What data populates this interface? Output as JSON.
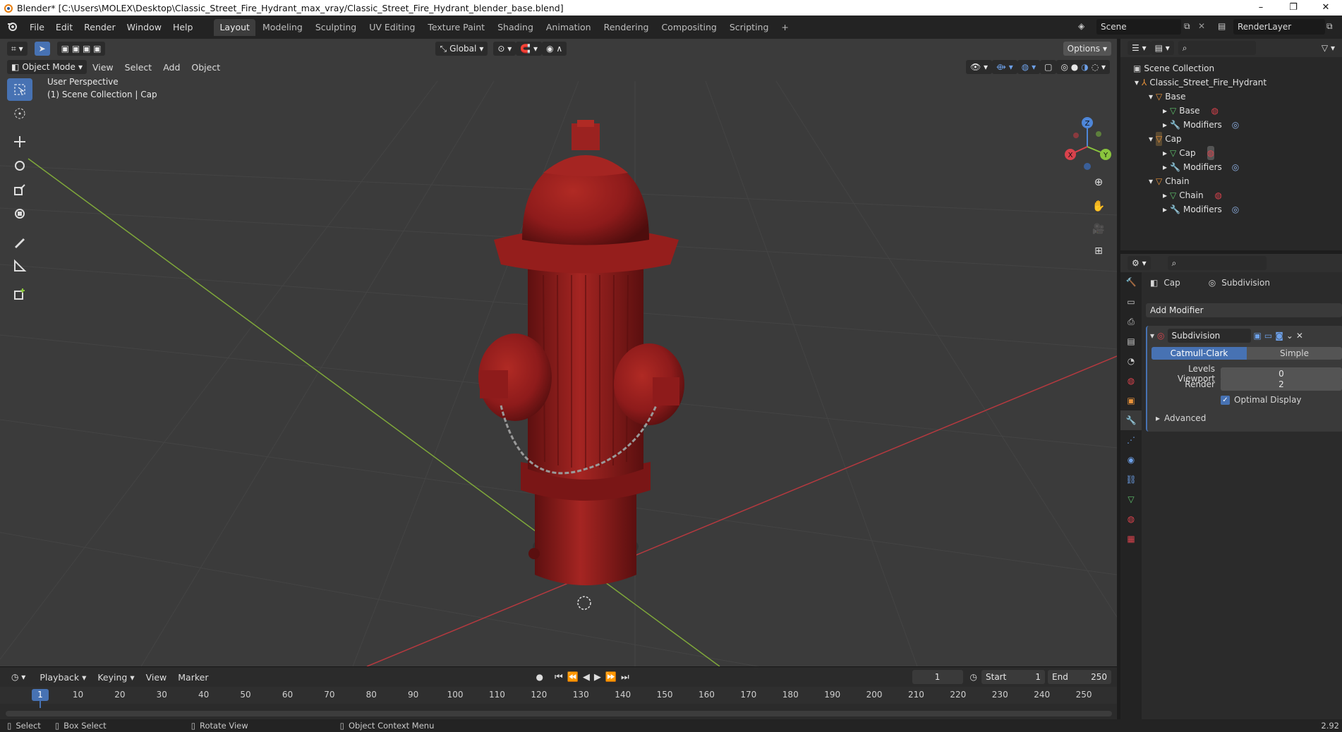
{
  "window": {
    "title": "Blender* [C:\\Users\\MOLEX\\Desktop\\Classic_Street_Fire_Hydrant_max_vray/Classic_Street_Fire_Hydrant_blender_base.blend]",
    "minimize": "–",
    "restore": "❐",
    "close": "✕"
  },
  "menu": [
    "File",
    "Edit",
    "Render",
    "Window",
    "Help"
  ],
  "workspaces": [
    "Layout",
    "Modeling",
    "Sculpting",
    "UV Editing",
    "Texture Paint",
    "Shading",
    "Animation",
    "Rendering",
    "Compositing",
    "Scripting",
    "+"
  ],
  "scene": {
    "name": "Scene",
    "view_layer": "RenderLayer"
  },
  "viewport": {
    "transform_orientation": "Global",
    "options": "Options",
    "mode": "Object Mode",
    "menus": [
      "View",
      "Select",
      "Add",
      "Object"
    ],
    "overlay_line1": "User Perspective",
    "overlay_line2": "(1) Scene Collection | Cap",
    "gizmo_axes": {
      "x": "X",
      "y": "Y",
      "z": "Z"
    }
  },
  "outliner": {
    "root": "Scene Collection",
    "collection": "Classic_Street_Fire_Hydrant",
    "objects": [
      {
        "name": "Base",
        "mesh": "Base",
        "modifiers": "Modifiers"
      },
      {
        "name": "Cap",
        "mesh": "Cap",
        "modifiers": "Modifiers"
      },
      {
        "name": "Chain",
        "mesh": "Chain",
        "modifiers": "Modifiers"
      }
    ]
  },
  "properties": {
    "breadcrumb_object": "Cap",
    "breadcrumb_modifier": "Subdivision",
    "add_modifier": "Add Modifier",
    "modifier_name": "Subdivision",
    "algo_options": [
      "Catmull-Clark",
      "Simple"
    ],
    "levels_viewport_label": "Levels Viewport",
    "levels_viewport": "0",
    "render_label": "Render",
    "render": "2",
    "optimal_display": "Optimal Display",
    "advanced": "Advanced"
  },
  "timeline": {
    "menus": [
      "Playback",
      "Keying",
      "View",
      "Marker"
    ],
    "current_frame": "1",
    "start_label": "Start",
    "start": "1",
    "end_label": "End",
    "end": "250",
    "ticks": [
      "1",
      "10",
      "20",
      "30",
      "40",
      "50",
      "60",
      "70",
      "80",
      "90",
      "100",
      "110",
      "120",
      "130",
      "140",
      "150",
      "160",
      "170",
      "180",
      "190",
      "200",
      "210",
      "220",
      "230",
      "240",
      "250"
    ]
  },
  "status": {
    "select": "Select",
    "box_select": "Box Select",
    "rotate_view": "Rotate View",
    "context_menu": "Object Context Menu",
    "version": "2.92"
  },
  "colors": {
    "accent": "#4772b3",
    "hydrant": "#8e1b1b",
    "x_axis": "#d9424c",
    "y_axis": "#8ac53d",
    "z_axis": "#4e86d8"
  }
}
